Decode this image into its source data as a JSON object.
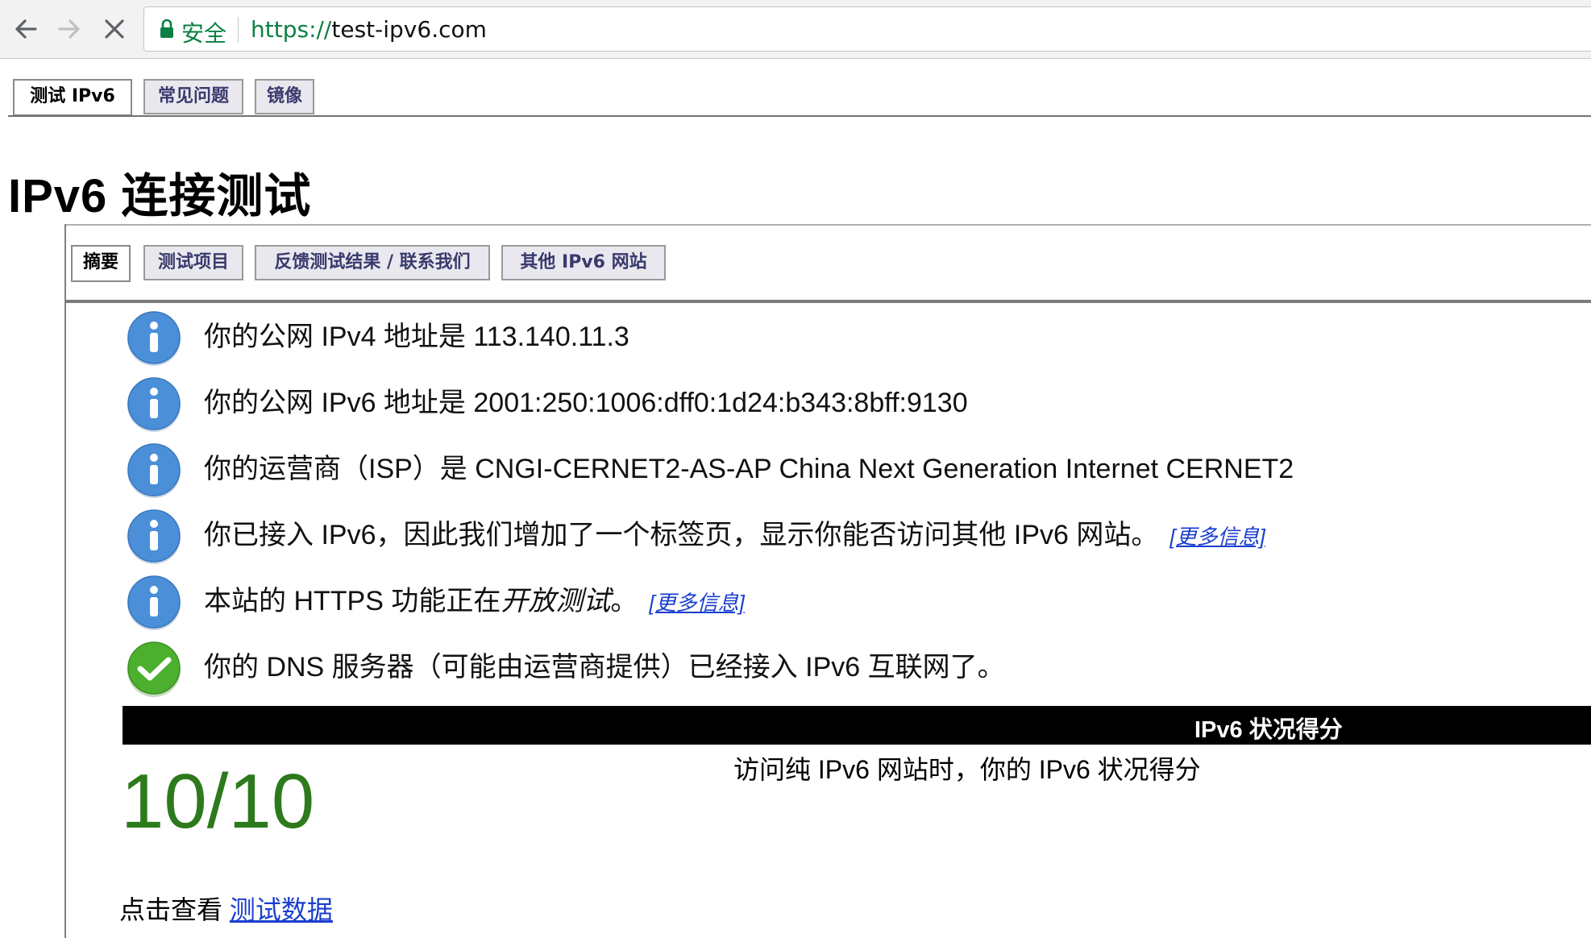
{
  "browser": {
    "secure_label": "安全",
    "url_scheme": "https://",
    "url_host": "test-ipv6.com"
  },
  "top_tabs": [
    {
      "label": "测试 IPv6",
      "active": true
    },
    {
      "label": "常见问题",
      "active": false
    },
    {
      "label": "镜像",
      "active": false
    }
  ],
  "page_title": "IPv6 连接测试",
  "sub_tabs": [
    {
      "label": "摘要",
      "active": true
    },
    {
      "label": "测试项目",
      "active": false
    },
    {
      "label": "反馈测试结果 / 联系我们",
      "active": false
    },
    {
      "label": "其他 IPv6 网站",
      "active": false
    }
  ],
  "info_rows": [
    {
      "icon": "info-icon",
      "text": "你的公网 IPv4 地址是 113.140.11.3"
    },
    {
      "icon": "info-icon",
      "text": "你的公网 IPv6 地址是 2001:250:1006:dff0:1d24:b343:8bff:9130"
    },
    {
      "icon": "info-icon",
      "text": "你的运营商（ISP）是 CNGI-CERNET2-AS-AP China Next Generation Internet CERNET2"
    },
    {
      "icon": "info-icon",
      "text": "你已接入 IPv6，因此我们增加了一个标签页，显示你能否访问其他 IPv6 网站。",
      "more": "[更多信息]"
    },
    {
      "icon": "info-icon",
      "text_before": "本站的 HTTPS 功能正在",
      "text_italic": "开放测试",
      "text_after": "。",
      "more": "[更多信息]"
    },
    {
      "icon": "check-icon",
      "text": "你的 DNS 服务器（可能由运营商提供）已经接入 IPv6 互联网了。"
    }
  ],
  "score": {
    "bar_title": "IPv6 状况得分",
    "value": "10/10",
    "description": "访问纯 IPv6 网站时，你的 IPv6 状况得分"
  },
  "footer": {
    "prefix": "点击查看 ",
    "link": "测试数据"
  },
  "colors": {
    "info_icon": "#4a8fd8",
    "check_icon": "#4caf2e",
    "score_green": "#2d7a1d",
    "link_blue": "#1a3ecf",
    "secure_green": "#0b8043"
  }
}
